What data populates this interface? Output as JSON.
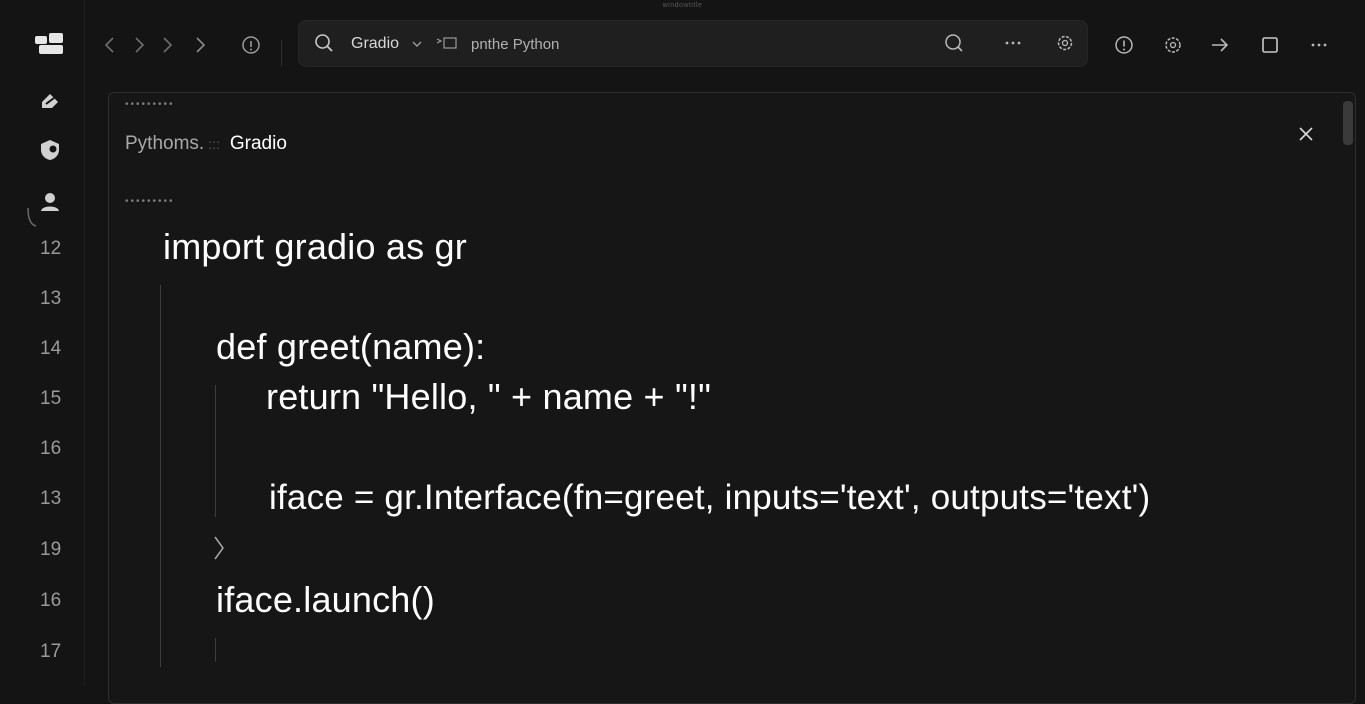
{
  "window": {
    "caption": "windowtitle"
  },
  "rail": {
    "icons": [
      "app-logo",
      "edit-icon",
      "shield-icon",
      "user-icon"
    ],
    "line_numbers": [
      "12",
      "13",
      "14",
      "15",
      "16",
      "13",
      "19",
      "16",
      "17"
    ]
  },
  "toolbar": {
    "nav": [
      "back-icon",
      "forward-icon",
      "forward-icon",
      "forward-icon"
    ],
    "address": {
      "project": "Gradio",
      "interpreter": "pnthe Python"
    }
  },
  "editor": {
    "tabs": {
      "inactive": "Pythoms.",
      "separator": ":::",
      "active": "Gradio"
    },
    "code": [
      "import gradio as gr",
      "def greet(name):",
      "return \"Hello, \" + name + \"!\"",
      "iface = gr.Interface(fn=greet, inputs='text', outputs='text')",
      "iface.launch()"
    ]
  },
  "colors": {
    "background": "#141414",
    "editor": "#161616",
    "text": "#ffffff"
  }
}
